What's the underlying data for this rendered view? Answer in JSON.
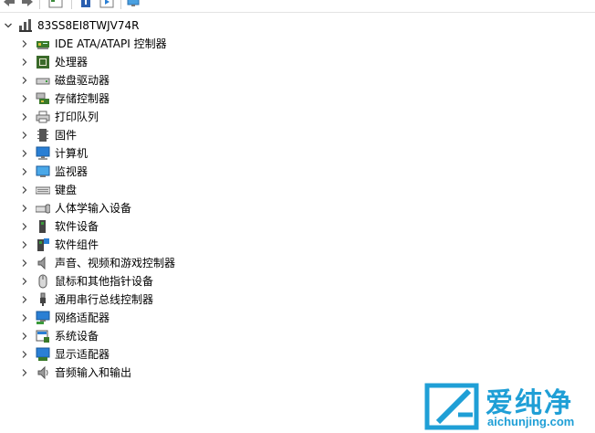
{
  "toolbar": {
    "buttons": [
      "back-arrow",
      "forward-arrow",
      "properties",
      "help",
      "update-driver",
      "scan-hardware"
    ]
  },
  "tree": {
    "root": {
      "label": "83SS8EI8TWJV74R",
      "icon": "computer-icon"
    },
    "items": [
      {
        "label": "IDE ATA/ATAPI 控制器",
        "icon": "ide-controller-icon"
      },
      {
        "label": "处理器",
        "icon": "processor-icon"
      },
      {
        "label": "磁盘驱动器",
        "icon": "disk-drive-icon"
      },
      {
        "label": "存储控制器",
        "icon": "storage-controller-icon"
      },
      {
        "label": "打印队列",
        "icon": "printer-icon"
      },
      {
        "label": "固件",
        "icon": "firmware-icon"
      },
      {
        "label": "计算机",
        "icon": "computer-monitor-icon"
      },
      {
        "label": "监视器",
        "icon": "monitor-icon"
      },
      {
        "label": "键盘",
        "icon": "keyboard-icon"
      },
      {
        "label": "人体学输入设备",
        "icon": "hid-icon"
      },
      {
        "label": "软件设备",
        "icon": "software-device-icon"
      },
      {
        "label": "软件组件",
        "icon": "software-component-icon"
      },
      {
        "label": "声音、视频和游戏控制器",
        "icon": "speaker-icon"
      },
      {
        "label": "鼠标和其他指针设备",
        "icon": "mouse-icon"
      },
      {
        "label": "通用串行总线控制器",
        "icon": "usb-icon"
      },
      {
        "label": "网络适配器",
        "icon": "network-adapter-icon"
      },
      {
        "label": "系统设备",
        "icon": "system-device-icon"
      },
      {
        "label": "显示适配器",
        "icon": "display-adapter-icon"
      },
      {
        "label": "音频输入和输出",
        "icon": "audio-io-icon"
      }
    ]
  },
  "watermark": {
    "brand": "爱纯净",
    "url": "aichunjing.com"
  },
  "colors": {
    "watermark_blue": "#1f9fd6",
    "icon_blue": "#2a7fd4",
    "chip_green": "#3a7a2a"
  }
}
